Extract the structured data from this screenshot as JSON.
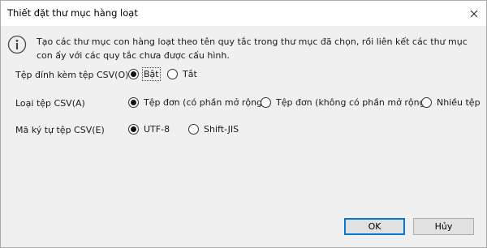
{
  "window": {
    "title": "Thiết đặt thư mục hàng loạt"
  },
  "info": {
    "text": "Tạo các thư mục con hàng loạt theo tên quy tắc trong thư mục đã chọn, rồi liên kết các thư mục con ấy với các quy tắc chưa được cấu hình."
  },
  "csv_attach": {
    "label": "Tệp đính kèm tệp CSV(O)",
    "options": [
      {
        "label": "Bật",
        "selected": true
      },
      {
        "label": "Tắt",
        "selected": false
      }
    ]
  },
  "csv_type": {
    "label": "Loại tệp CSV(A)",
    "options": [
      {
        "label": "Tệp đơn (có phần mở rộng)",
        "selected": true
      },
      {
        "label": "Tệp đơn (không có phần mở rộng)",
        "selected": false
      },
      {
        "label": "Nhiều tệp",
        "selected": false
      }
    ]
  },
  "csv_encoding": {
    "label": "Mã ký tự tệp CSV(E)",
    "options": [
      {
        "label": "UTF-8",
        "selected": true
      },
      {
        "label": "Shift-JIS",
        "selected": false
      }
    ]
  },
  "buttons": {
    "ok": "OK",
    "cancel": "Hủy"
  },
  "icons": {
    "info": "info-icon",
    "close": "close-icon"
  }
}
